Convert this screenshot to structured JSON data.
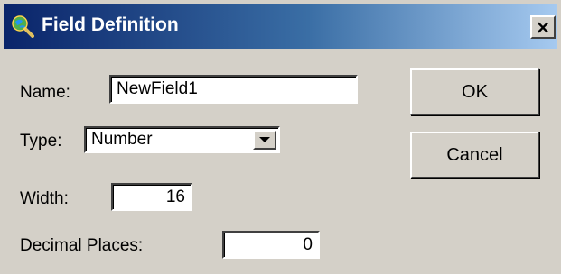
{
  "window": {
    "title": "Field Definition",
    "close_label": "×"
  },
  "form": {
    "name_label": "Name:",
    "name_value": "NewField1",
    "type_label": "Type:",
    "type_value": "Number",
    "width_label": "Width:",
    "width_value": "16",
    "decimal_label": "Decimal Places:",
    "decimal_value": "0"
  },
  "buttons": {
    "ok": "OK",
    "cancel": "Cancel"
  },
  "colors": {
    "titlebar_start": "#0a246a",
    "titlebar_end": "#a6caf0",
    "dialog_bg": "#d4d0c8"
  },
  "icons": {
    "title": "magnifier-globe-icon",
    "close": "close-icon",
    "dropdown": "chevron-down-icon"
  }
}
